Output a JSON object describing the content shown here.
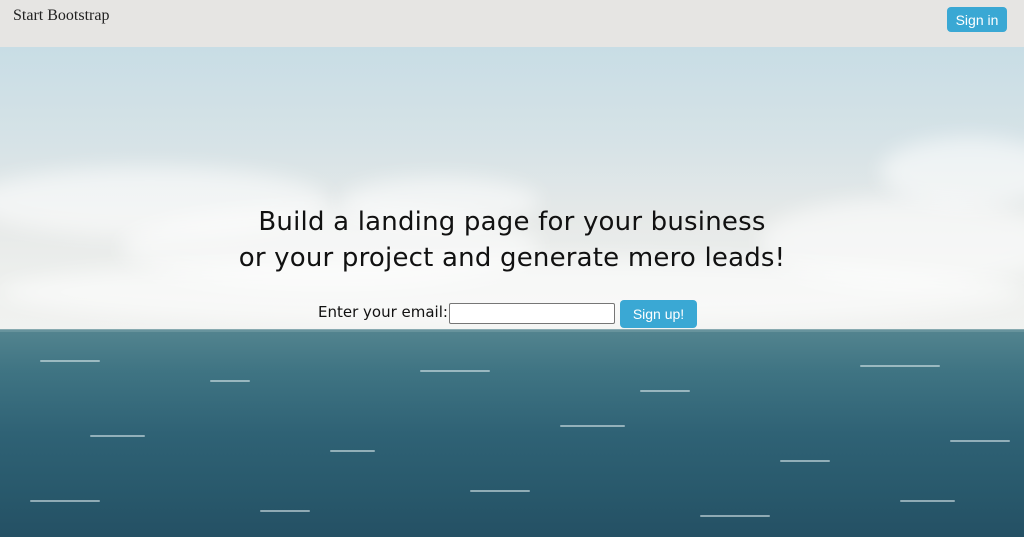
{
  "navbar": {
    "brand": "Start Bootstrap",
    "signin_label": "Sign in"
  },
  "hero": {
    "headline_line1": "Build a landing page for your business",
    "headline_line2": "or your project and generate mero leads!",
    "email_label": "Enter your email:",
    "email_value": "",
    "email_placeholder": "",
    "signup_label": "Sign up!"
  },
  "colors": {
    "navbar_bg": "#e6e5e3",
    "button_bg": "#3aa8d4",
    "text": "#111111"
  }
}
